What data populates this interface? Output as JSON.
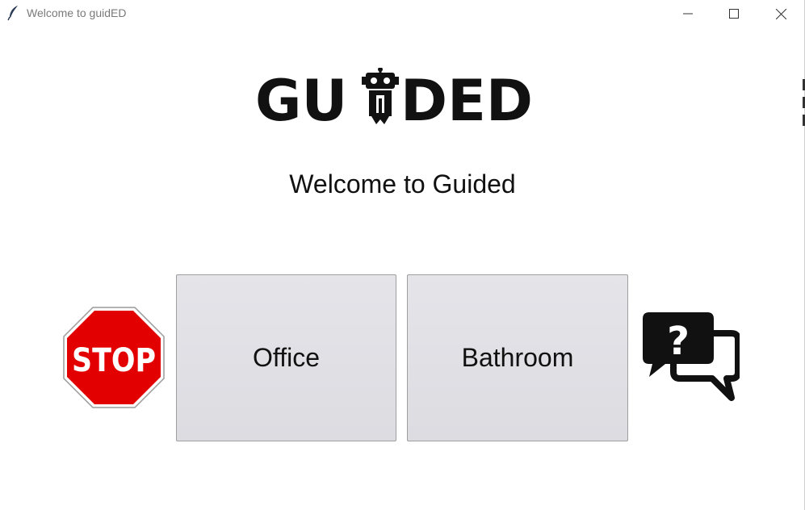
{
  "window": {
    "title": "Welcome to guidED",
    "icon": "feather-icon",
    "controls": [
      "minimize-icon",
      "maximize-icon",
      "close-icon"
    ]
  },
  "logo": {
    "text": "GUIDED",
    "icon": "robot-icon"
  },
  "welcome_text": "Welcome to Guided",
  "buttons": {
    "office_label": "Office",
    "bathroom_label": "Bathroom"
  },
  "stop_sign": {
    "text": "STOP",
    "color": "#e30000"
  },
  "help_icon": "question-chat-icon"
}
